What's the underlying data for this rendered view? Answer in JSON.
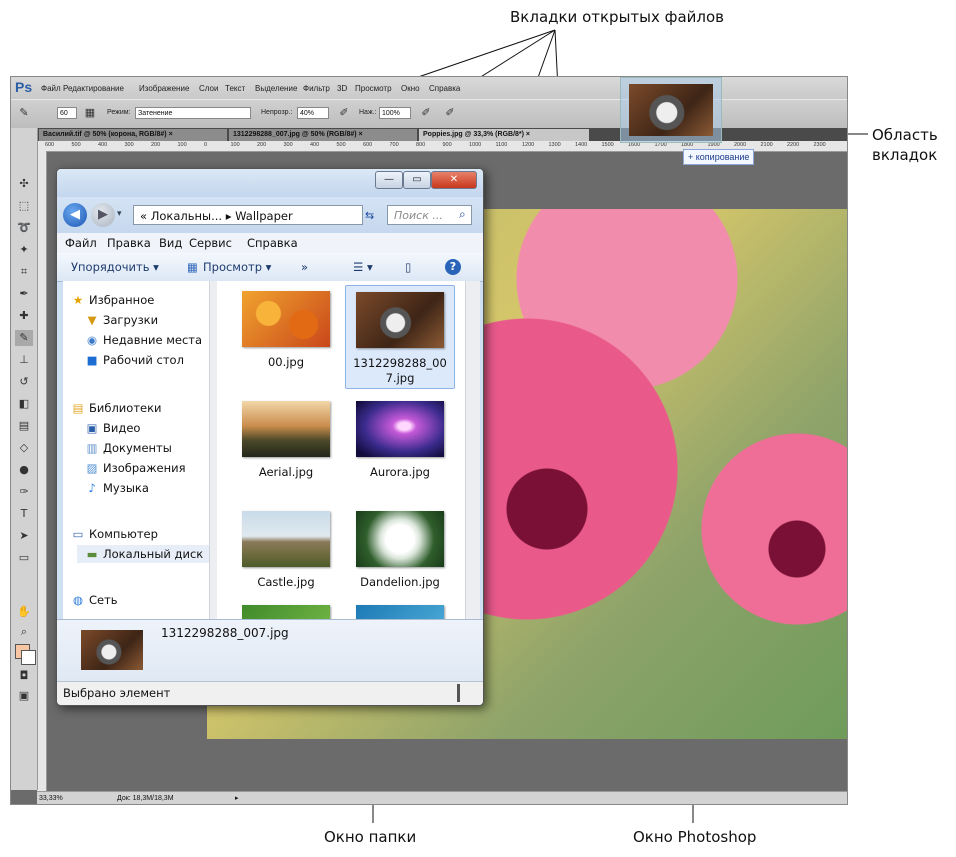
{
  "callouts": {
    "tabs_files": "Вкладки открытых файлов",
    "tab_area_line1": "Область",
    "tab_area_line2": "вкладок",
    "folder_window": "Окно папки",
    "photoshop_window": "Окно Photoshop"
  },
  "photoshop": {
    "logo": "Ps",
    "menu": [
      "Файл",
      "Редактирование",
      "Изображение",
      "Слои",
      "Текст",
      "Выделение",
      "Фильтр",
      "3D",
      "Просмотр",
      "Окно",
      "Справка"
    ],
    "options": {
      "brush_size": "60",
      "mode_label": "Режим:",
      "mode_value": "Затенение",
      "opacity_label": "Непрозр.:",
      "opacity_value": "40%",
      "pressure_label": "Наж.:",
      "pressure_value": "100%"
    },
    "tabs": [
      "Василий.tif @ 50% (корона, RGB/8#)",
      "1312298288_007.jpg @ 50% (RGB/8#)",
      "Poppies.jpg @ 33,3% (RGB/8*)"
    ],
    "tab_close": "×",
    "ruler_ticks": [
      "600",
      "500",
      "400",
      "300",
      "200",
      "100",
      "0",
      "100",
      "200",
      "300",
      "400",
      "500",
      "600",
      "700",
      "800",
      "900",
      "1000",
      "1100",
      "1200",
      "1300",
      "1400",
      "1500",
      "1600",
      "1700",
      "1800",
      "1900",
      "2000",
      "2100",
      "2200",
      "2300"
    ],
    "status": {
      "zoom": "33,33%",
      "doc": "Док: 18,3M/18,3M"
    },
    "colors": {
      "foreground": "#f8c6a3",
      "background": "#ffffff"
    }
  },
  "drag": {
    "tooltip": "+ копирование"
  },
  "explorer": {
    "address": "« Локальны... ▸ Wallpaper",
    "search_placeholder": "Поиск ...",
    "menu": [
      "Файл",
      "Правка",
      "Вид",
      "Сервис",
      "Справка"
    ],
    "commands": {
      "organize": "Упорядочить ▾",
      "view": "Просмотр ▾",
      "more": "»"
    },
    "nav": {
      "favorites": "Избранное",
      "downloads": "Загрузки",
      "recent": "Недавние места",
      "desktop": "Рабочий стол",
      "libraries": "Библиотеки",
      "video": "Видео",
      "documents": "Документы",
      "pictures": "Изображения",
      "music": "Музыка",
      "computer": "Компьютер",
      "local_disk": "Локальный диск",
      "network": "Сеть"
    },
    "files": [
      {
        "name": "00.jpg"
      },
      {
        "name": "1312298288_007.jpg"
      },
      {
        "name": "Aerial.jpg"
      },
      {
        "name": "Aurora.jpg"
      },
      {
        "name": "Castle.jpg"
      },
      {
        "name": "Dandelion.jpg"
      }
    ],
    "details_name": "1312298288_007.jpg",
    "status": "Выбрано элемент"
  }
}
